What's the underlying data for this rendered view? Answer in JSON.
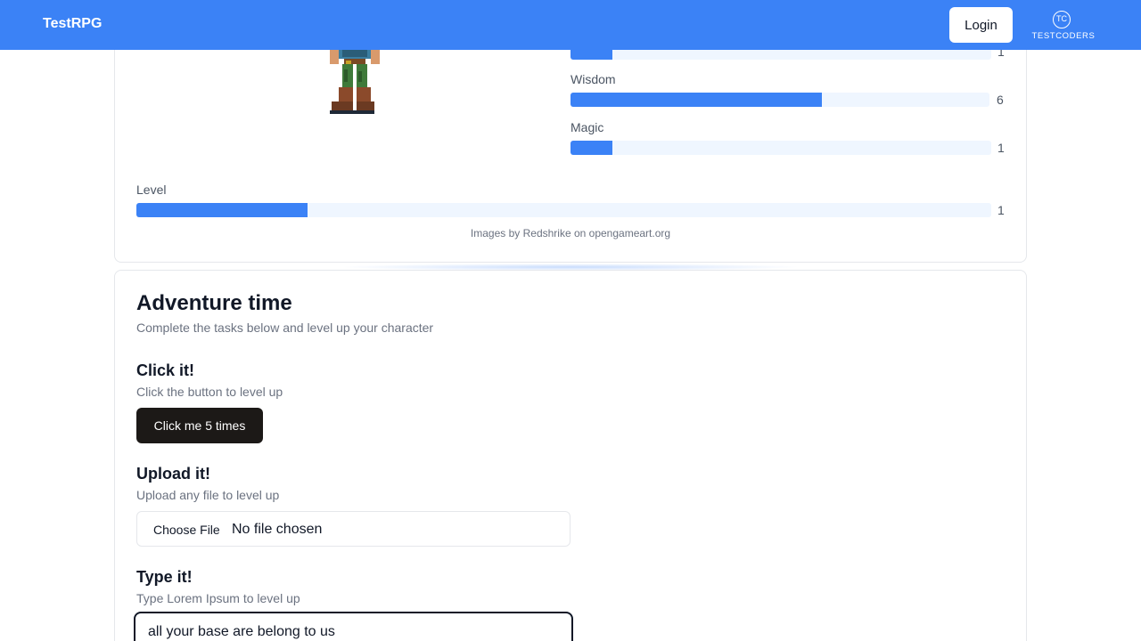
{
  "header": {
    "brand": "TestRPG",
    "login_label": "Login",
    "partner_logo_text": "TESTCODERS",
    "partner_logo_initials": "TC",
    "accent_color": "#3b82f6"
  },
  "character": {
    "stats": [
      {
        "label": "",
        "value": "1",
        "fraction": 0.1
      },
      {
        "label": "Wisdom",
        "value": "6",
        "fraction": 0.6
      },
      {
        "label": "Magic",
        "value": "1",
        "fraction": 0.1
      }
    ],
    "level": {
      "label": "Level",
      "value": "1",
      "fraction": 0.2
    },
    "credit": "Images by Redshrike on opengameart.org"
  },
  "adventure": {
    "title": "Adventure time",
    "subtitle": "Complete the tasks below and level up your character",
    "tasks": {
      "click": {
        "title": "Click it!",
        "description": "Click the button to level up",
        "button_label": "Click me 5 times"
      },
      "upload": {
        "title": "Upload it!",
        "description": "Upload any file to level up",
        "choose_label": "Choose File",
        "status": "No file chosen"
      },
      "type": {
        "title": "Type it!",
        "description": "Type Lorem Ipsum to level up",
        "value": "all your base are belong to us"
      }
    }
  }
}
